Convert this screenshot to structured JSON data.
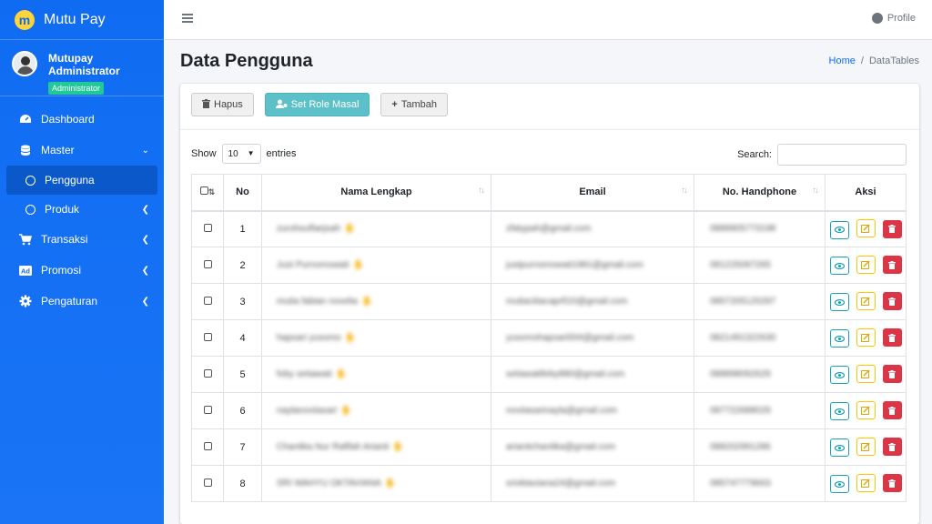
{
  "brand": {
    "name": "Mutu Pay",
    "logo_letter": "m"
  },
  "user": {
    "name": "Mutupay Administrator",
    "role": "Administrator"
  },
  "sidebar": {
    "items": [
      {
        "label": "Dashboard",
        "icon": "dashboard-icon"
      },
      {
        "label": "Master",
        "icon": "database-icon"
      },
      {
        "label": "Pengguna",
        "icon": "circle-icon"
      },
      {
        "label": "Produk",
        "icon": "circle-icon"
      },
      {
        "label": "Transaksi",
        "icon": "cart-icon"
      },
      {
        "label": "Promosi",
        "icon": "ad-icon"
      },
      {
        "label": "Pengaturan",
        "icon": "gear-icon"
      }
    ]
  },
  "topbar": {
    "profile_label": "Profile"
  },
  "header": {
    "title": "Data Pengguna",
    "breadcrumb_home": "Home",
    "breadcrumb_current": "DataTables"
  },
  "toolbar": {
    "delete_label": "Hapus",
    "role_label": "Set Role Masal",
    "add_label": "Tambah"
  },
  "table_controls": {
    "show_label": "Show",
    "entries_value": "10",
    "entries_label": "entries",
    "search_label": "Search:"
  },
  "table": {
    "headers": [
      "No",
      "Nama Lengkap",
      "Email",
      "No. Handphone",
      "Aksi"
    ],
    "rows": [
      {
        "no": "1",
        "name": "zurohsulfaejsah",
        "email": "zfatypah@gmail.com",
        "phone": "0889905773198"
      },
      {
        "no": "2",
        "name": "Just Purnomowati",
        "email": "justpurnomowati1981@gmail.com",
        "phone": "081225097265"
      },
      {
        "no": "3",
        "name": "mutia fabian novelia",
        "email": "mutiaciitacaprfi10@gmail.com",
        "phone": "0857205120297"
      },
      {
        "no": "4",
        "name": "hapsari yusomo",
        "email": "yusomohapsari004@gmail.com",
        "phone": "0821491322630"
      },
      {
        "no": "5",
        "name": "foby setiawati",
        "email": "setiawatifeby880@gmail.com",
        "phone": "088898092629"
      },
      {
        "no": "6",
        "name": "naylanoviiasari",
        "email": "noviiasarinayla@gmail.com",
        "phone": "087722688029"
      },
      {
        "no": "7",
        "name": "Chantika Nur Rafifah Arianti",
        "email": "ariantichantika@gmail.com",
        "phone": "088202991286"
      },
      {
        "no": "8",
        "name": "SRI WAHYU OKTAVIANA",
        "email": "srioktaviana24@gmail.com",
        "phone": "085747779663"
      }
    ]
  },
  "colors": {
    "sidebar": "#0f6cf2",
    "accent_info": "#5bc0c8",
    "danger": "#dc3545",
    "warning": "#ffc107",
    "view": "#17a2b8"
  }
}
